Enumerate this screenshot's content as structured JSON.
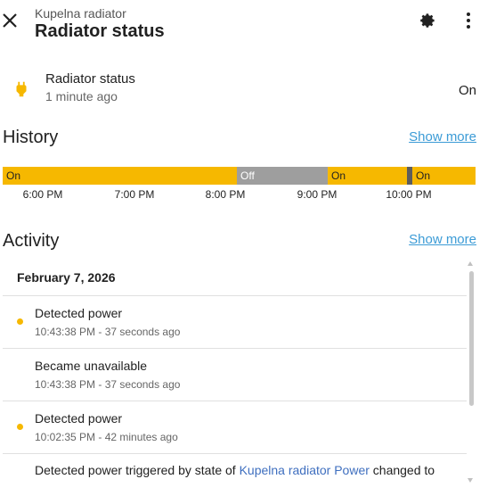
{
  "header": {
    "subtitle": "Kupelna radiator",
    "title": "Radiator status"
  },
  "entity": {
    "name": "Radiator status",
    "last_changed": "1 minute ago",
    "state": "On",
    "icon": "power-plug-icon"
  },
  "history": {
    "title": "History",
    "show_more": "Show more",
    "segments": [
      {
        "label": "On",
        "state": "on"
      },
      {
        "label": "Off",
        "state": "off"
      },
      {
        "label": "On",
        "state": "on"
      },
      {
        "label": "",
        "state": "unavailable"
      },
      {
        "label": "On",
        "state": "on"
      }
    ],
    "ticks": [
      "6:00 PM",
      "7:00 PM",
      "8:00 PM",
      "9:00 PM",
      "10:00 PM"
    ]
  },
  "activity": {
    "title": "Activity",
    "show_more": "Show more",
    "date": "February 7, 2026",
    "events": [
      {
        "title": "Detected power",
        "time": "10:43:38 PM - 37 seconds ago",
        "dot": true
      },
      {
        "title": "Became unavailable",
        "time": "10:43:38 PM - 37 seconds ago",
        "dot": false
      },
      {
        "title": "Detected power",
        "time": "10:02:35 PM - 42 minutes ago",
        "dot": true
      }
    ],
    "last_event": {
      "prefix": "Detected power triggered by state of ",
      "link": "Kupelna radiator Power",
      "suffix": " changed to"
    }
  },
  "colors": {
    "on": "#f6b800",
    "off": "#9e9e9e",
    "unavailable": "#5d5d5d",
    "link": "#3b9bd6"
  }
}
